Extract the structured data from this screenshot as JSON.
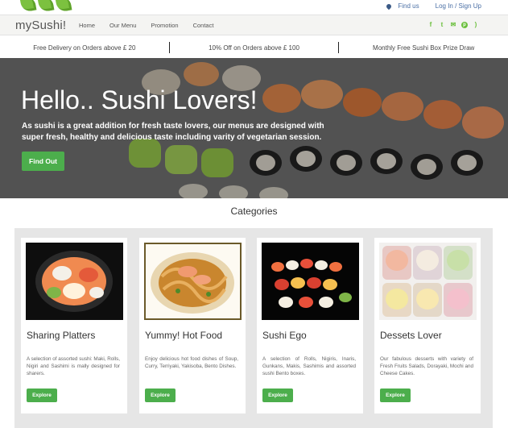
{
  "topbar": {
    "find_us": "Find us",
    "login": "Log In / Sign Up"
  },
  "nav": {
    "brand": "mySushi!",
    "items": [
      {
        "label": "Home"
      },
      {
        "label": "Our Menu"
      },
      {
        "label": "Promotion"
      },
      {
        "label": "Contact"
      }
    ],
    "social_icons": [
      "facebook-icon",
      "twitter-icon",
      "email-icon",
      "pinterest-icon",
      "rss-icon"
    ]
  },
  "promo": [
    "Free Delivery on Orders above £ 20",
    "10% Off on Orders above £ 100",
    "Monthly Free Sushi Box Prize Draw"
  ],
  "hero": {
    "title": "Hello.. Sushi Lovers!",
    "text": "As sushi is a great addition for fresh taste lovers, our menus are designed with super fresh, healthy and delicious taste including varity of vegetarian session.",
    "button": "Find Out"
  },
  "categories": {
    "title": "Categories",
    "cards": [
      {
        "name": "Sharing Platters",
        "description": "A selection of assorted sushi: Maki, Rolls, Nigiri and Sashimi is mally designed for sharers.",
        "button": "Explore"
      },
      {
        "name": "Yummy! Hot Food",
        "description": "Enjoy delicious hot food dishes of Soup, Curry, Terriyaki, Yakisoba, Bento Dishes.",
        "button": "Explore"
      },
      {
        "name": "Sushi Ego",
        "description": "A selection of Rolls, Nigiris, Inaris, Gunkans, Makis, Sashimis and assorted sushi Bento boxes.",
        "button": "Explore"
      },
      {
        "name": "Dessets Lover",
        "description": "Our fabulous desserts with variety of Fresh Fruits Salads, Dorayaki, Mochi and Cheese Cakes.",
        "button": "Explore"
      }
    ]
  },
  "colors": {
    "accent_green": "#4cae4c",
    "link_blue": "#4a6fa5"
  }
}
